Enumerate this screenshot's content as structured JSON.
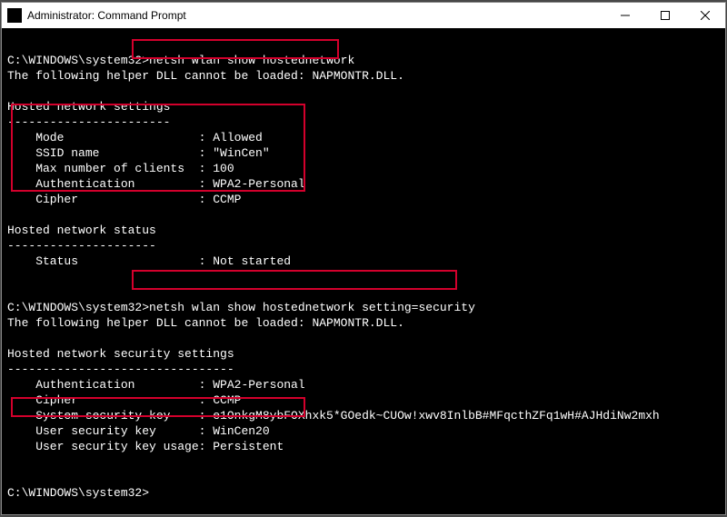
{
  "titlebar": {
    "title": "Administrator: Command Prompt"
  },
  "prompt": "C:\\WINDOWS\\system32>",
  "cmd1": "netsh wlan show hostednetwork",
  "dll_line": "The following helper DLL cannot be loaded: NAPMONTR.DLL.",
  "sec_settings_hdr": "Hosted network settings",
  "dashes23": "-----------------------",
  "settings": {
    "mode": "    Mode                   : Allowed",
    "ssid": "    SSID name              : \"WinCen\"",
    "maxclients": "    Max number of clients  : 100",
    "auth": "    Authentication         : WPA2-Personal",
    "cipher": "    Cipher                 : CCMP"
  },
  "sec_status_hdr": "Hosted network status",
  "dashes21": "---------------------",
  "status_line": "    Status                 : Not started",
  "cmd2": "netsh wlan show hostednetwork setting=security",
  "sec_security_hdr": "Hosted network security settings",
  "dashes32": "--------------------------------",
  "security": {
    "auth": "    Authentication         : WPA2-Personal",
    "cipher": "    Cipher                 : CCMP",
    "syskey": "    System security key    : e1OnkgM8ybFOXhxk5*GOedk~CUOw!xwv8InlbB#MFqcthZFq1wH#AJHdiNw2mxh",
    "userkey": "    User security key      : WinCen20",
    "usage": "    User security key usage: Persistent"
  }
}
